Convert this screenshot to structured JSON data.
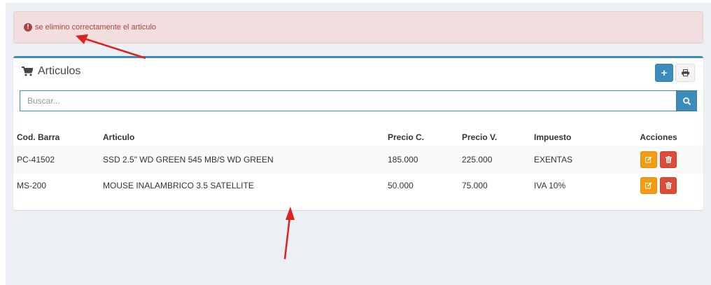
{
  "alert": {
    "icon": "exclamation-circle-icon",
    "message": "se elimino correctamente el articulo",
    "color": "#a94442"
  },
  "panel": {
    "icon": "shopping-cart-icon",
    "title": "Articulos",
    "add_icon": "plus-icon",
    "print_icon": "print-icon",
    "accent_color": "#3c8dbc"
  },
  "search": {
    "placeholder": "Buscar...",
    "value": "",
    "icon": "search-icon"
  },
  "table": {
    "columns": [
      "Cod. Barra",
      "Articulo",
      "Precio C.",
      "Precio V.",
      "Impuesto",
      "Acciones"
    ],
    "rows": [
      {
        "cod": "PC-41502",
        "articulo": "SSD 2.5\" WD GREEN 545 MB/S WD GREEN",
        "precio_c": "185.000",
        "precio_v": "225.000",
        "impuesto": "EXENTAS"
      },
      {
        "cod": "MS-200",
        "articulo": "MOUSE INALAMBRICO 3.5 SATELLITE",
        "precio_c": "50.000",
        "precio_v": "75.000",
        "impuesto": "IVA 10%"
      }
    ],
    "edit_icon": "edit-icon",
    "delete_icon": "trash-icon",
    "edit_color": "#f39c12",
    "delete_color": "#dd4b39"
  },
  "annotations": {
    "arrow_color": "#e0201b"
  }
}
